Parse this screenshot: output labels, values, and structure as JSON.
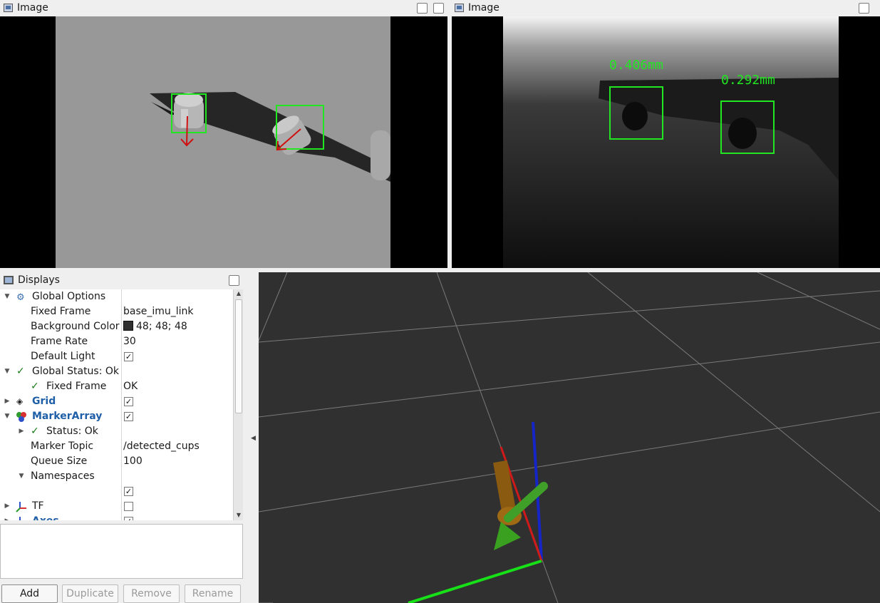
{
  "image_panels": [
    {
      "title": "Image"
    },
    {
      "title": "Image",
      "labels": [
        "0.406mm",
        "0.292mm"
      ]
    }
  ],
  "displays": {
    "title": "Displays",
    "tree": [
      {
        "label": "Global Options",
        "value": ""
      },
      {
        "label": "Fixed Frame",
        "value": "base_imu_link"
      },
      {
        "label": "Background Color",
        "value": "48; 48; 48"
      },
      {
        "label": "Frame Rate",
        "value": "30"
      },
      {
        "label": "Default Light",
        "value": ""
      },
      {
        "label": "Global Status: Ok",
        "value": ""
      },
      {
        "label": "Fixed Frame",
        "value": "OK"
      },
      {
        "label": "Grid",
        "value": ""
      },
      {
        "label": "MarkerArray",
        "value": ""
      },
      {
        "label": "Status: Ok",
        "value": ""
      },
      {
        "label": "Marker Topic",
        "value": "/detected_cups"
      },
      {
        "label": "Queue Size",
        "value": "100"
      },
      {
        "label": "Namespaces",
        "value": ""
      },
      {
        "label": "",
        "value": ""
      },
      {
        "label": "TF",
        "value": ""
      },
      {
        "label": "Axes",
        "value": ""
      }
    ],
    "checkboxes": {
      "default_light": true,
      "grid": true,
      "marker_array": true,
      "namespace_item": true,
      "tf": false,
      "axes": true
    },
    "buttons": {
      "add": "Add",
      "duplicate": "Duplicate",
      "remove": "Remove",
      "rename": "Rename"
    }
  },
  "colors": {
    "background": "#303030",
    "detection_box": "#22e622",
    "link_blue": "#1e5fa8"
  }
}
